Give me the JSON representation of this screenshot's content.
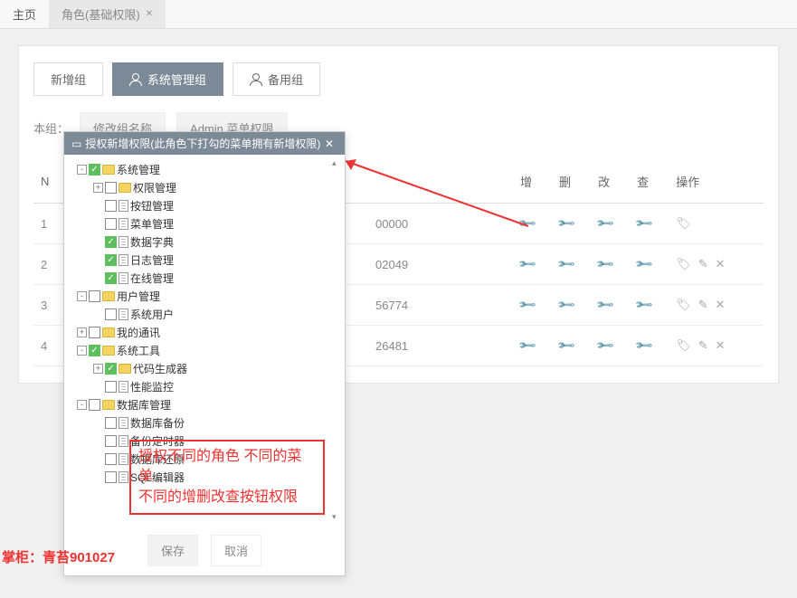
{
  "tabs": {
    "home": "主页",
    "current": "角色(基础权限)"
  },
  "toolbar": {
    "newGroup": "新增组",
    "sysGroup": "系统管理组",
    "spareGroup": "备用组"
  },
  "sub": {
    "label": "本组：",
    "rename": "修改组名称",
    "adminMenu": "Admin 菜单权限"
  },
  "cols": {
    "n": "N",
    "add": "增",
    "del": "删",
    "mod": "改",
    "qry": "查",
    "op": "操作"
  },
  "rows": [
    {
      "n": "1",
      "code": "00000",
      "ops": "tag"
    },
    {
      "n": "2",
      "code": "02049",
      "ops": "full"
    },
    {
      "n": "3",
      "code": "56774",
      "ops": "full"
    },
    {
      "n": "4",
      "code": "26481",
      "ops": "full"
    }
  ],
  "modal": {
    "title": "授权新增权限(此角色下打勾的菜单拥有新增权限)",
    "tree": [
      {
        "d": 0,
        "t": "-",
        "c": true,
        "i": "folder",
        "l": "系统管理"
      },
      {
        "d": 1,
        "t": "+",
        "c": false,
        "i": "folder",
        "l": "权限管理"
      },
      {
        "d": 1,
        "t": "",
        "c": false,
        "i": "file",
        "l": "按钮管理"
      },
      {
        "d": 1,
        "t": "",
        "c": false,
        "i": "file",
        "l": "菜单管理"
      },
      {
        "d": 1,
        "t": "",
        "c": true,
        "i": "file",
        "l": "数据字典"
      },
      {
        "d": 1,
        "t": "",
        "c": true,
        "i": "file",
        "l": "日志管理"
      },
      {
        "d": 1,
        "t": "",
        "c": true,
        "i": "file",
        "l": "在线管理"
      },
      {
        "d": 0,
        "t": "-",
        "c": false,
        "i": "folder",
        "l": "用户管理"
      },
      {
        "d": 1,
        "t": "",
        "c": false,
        "i": "file",
        "l": "系统用户"
      },
      {
        "d": 0,
        "t": "+",
        "c": false,
        "i": "folder",
        "l": "我的通讯"
      },
      {
        "d": 0,
        "t": "-",
        "c": true,
        "i": "folder",
        "l": "系统工具"
      },
      {
        "d": 1,
        "t": "+",
        "c": true,
        "i": "folder",
        "l": "代码生成器"
      },
      {
        "d": 1,
        "t": "",
        "c": false,
        "i": "file",
        "l": "性能监控"
      },
      {
        "d": 0,
        "t": "-",
        "c": false,
        "i": "folder",
        "l": "数据库管理"
      },
      {
        "d": 1,
        "t": "",
        "c": false,
        "i": "file",
        "l": "数据库备份"
      },
      {
        "d": 1,
        "t": "",
        "c": false,
        "i": "file",
        "l": "备份定时器"
      },
      {
        "d": 1,
        "t": "",
        "c": false,
        "i": "file",
        "l": "数据库还原"
      },
      {
        "d": 1,
        "t": "",
        "c": false,
        "i": "file",
        "l": "SQL编辑器"
      }
    ],
    "note1": "授权不同的角色 不同的菜单",
    "note2": "不同的增删改查按钮权限",
    "save": "保存",
    "cancel": "取消"
  },
  "owner": "掌柜：青苔901027"
}
